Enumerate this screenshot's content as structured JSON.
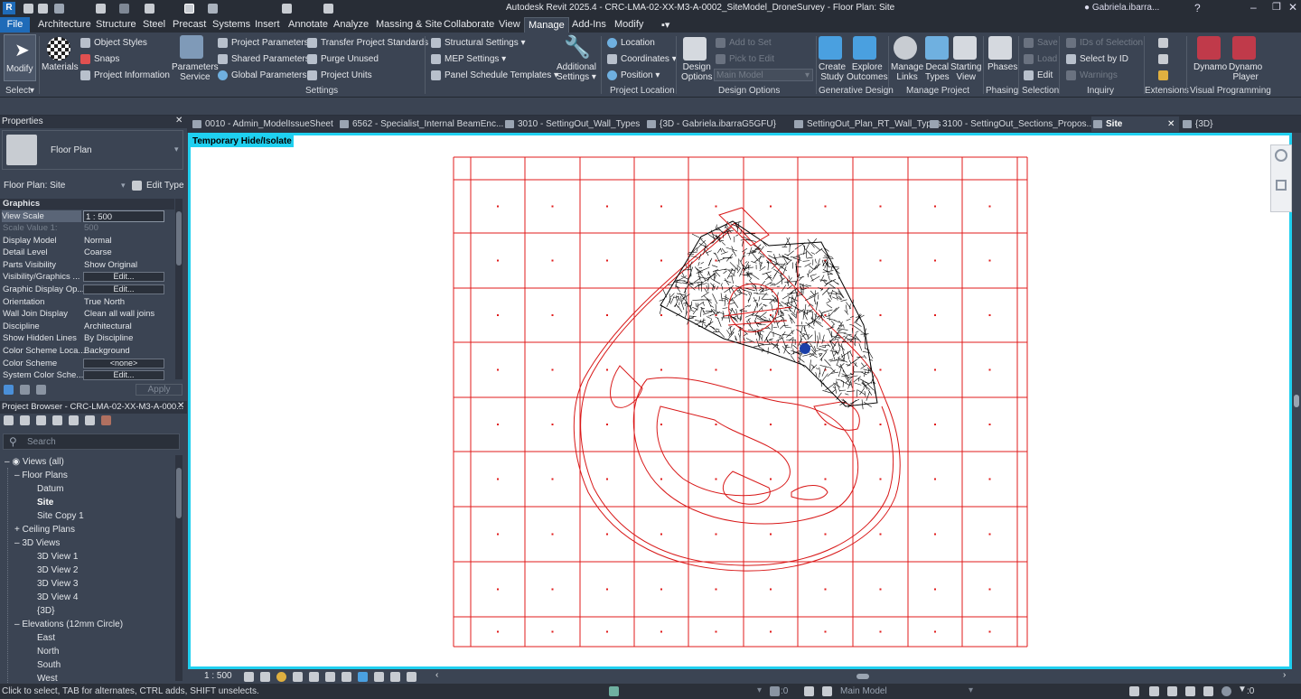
{
  "title": "Autodesk Revit 2025.4 - CRC-LMA-02-XX-M3-A-0002_SiteModel_DroneSurvey - Floor Plan: Site",
  "user": "Gabriela.ibarra...",
  "menu": [
    "File",
    "Architecture",
    "Structure",
    "Steel",
    "Precast",
    "Systems",
    "Insert",
    "Annotate",
    "Analyze",
    "Massing & Site",
    "Collaborate",
    "View",
    "Manage",
    "Add-Ins",
    "Modify"
  ],
  "ribbon": {
    "modify": "Modify",
    "select": "Select",
    "materials": "Materials",
    "object_styles": "Object Styles",
    "snaps": "Snaps",
    "project_information": "Project Information",
    "parameters_service": "Parameters Service",
    "project_parameters": "Project Parameters",
    "shared_parameters": "Shared Parameters",
    "global_parameters": "Global Parameters",
    "transfer_standards": "Transfer Project Standards",
    "purge_unused": "Purge Unused",
    "project_units": "Project Units",
    "settings_group": "Settings",
    "structural_settings": "Structural Settings",
    "mep_settings": "MEP Settings",
    "panel_schedule": "Panel Schedule Templates",
    "additional_settings": "Additional Settings",
    "location": "Location",
    "coordinates": "Coordinates",
    "position": "Position",
    "project_location_group": "Project Location",
    "design_options": "Design Options",
    "add_to_set": "Add to Set",
    "pick_to_edit": "Pick to Edit",
    "main_model": "Main Model",
    "design_options_group": "Design Options",
    "create_study": "Create Study",
    "explore_outcomes": "Explore Outcomes",
    "generative_design_group": "Generative Design",
    "manage_links": "Manage Links",
    "decal_types": "Decal Types",
    "starting_view": "Starting View",
    "manage_project_group": "Manage Project",
    "phases": "Phases",
    "phasing_group": "Phasing",
    "save": "Save",
    "load": "Load",
    "edit": "Edit",
    "selection_group": "Selection",
    "ids_of_selection": "IDs of Selection",
    "select_by_id": "Select by ID",
    "warnings": "Warnings",
    "inquiry_group": "Inquiry",
    "extensions_group": "Extensions",
    "dynamo": "Dynamo",
    "dynamo_player": "Dynamo Player",
    "visual_programming_group": "Visual Programming"
  },
  "properties": {
    "header": "Properties",
    "type_name": "Floor Plan",
    "selector": "Floor Plan: Site",
    "edit_type": "Edit Type",
    "section": "Graphics",
    "rows": [
      {
        "label": "View Scale",
        "value": "1 : 500"
      },
      {
        "label": "Scale Value    1:",
        "value": "500"
      },
      {
        "label": "Display Model",
        "value": "Normal"
      },
      {
        "label": "Detail Level",
        "value": "Coarse"
      },
      {
        "label": "Parts Visibility",
        "value": "Show Original"
      },
      {
        "label": "Visibility/Graphics ...",
        "value": "Edit..."
      },
      {
        "label": "Graphic Display Op...",
        "value": "Edit..."
      },
      {
        "label": "Orientation",
        "value": "True North"
      },
      {
        "label": "Wall Join Display",
        "value": "Clean all wall joins"
      },
      {
        "label": "Discipline",
        "value": "Architectural"
      },
      {
        "label": "Show Hidden Lines",
        "value": "By Discipline"
      },
      {
        "label": "Color Scheme Loca...",
        "value": "Background"
      },
      {
        "label": "Color Scheme",
        "value": "<none>"
      },
      {
        "label": "System Color Sche...",
        "value": "Edit..."
      }
    ],
    "apply": "Apply"
  },
  "browser": {
    "header": "Project Browser - CRC-LMA-02-XX-M3-A-000...",
    "search_placeholder": "Search",
    "items": [
      {
        "label": "Views (all)",
        "indent": 0
      },
      {
        "label": "Floor Plans",
        "indent": 1
      },
      {
        "label": "Datum",
        "indent": 2
      },
      {
        "label": "Site",
        "indent": 2,
        "bold": true
      },
      {
        "label": "Site Copy 1",
        "indent": 2
      },
      {
        "label": "Ceiling Plans",
        "indent": 1
      },
      {
        "label": "3D Views",
        "indent": 1
      },
      {
        "label": "3D View 1",
        "indent": 2
      },
      {
        "label": "3D View 2",
        "indent": 2
      },
      {
        "label": "3D View 3",
        "indent": 2
      },
      {
        "label": "3D View 4",
        "indent": 2
      },
      {
        "label": "{3D}",
        "indent": 2
      },
      {
        "label": "Elevations (12mm Circle)",
        "indent": 1
      },
      {
        "label": "East",
        "indent": 2
      },
      {
        "label": "North",
        "indent": 2
      },
      {
        "label": "South",
        "indent": 2
      },
      {
        "label": "West",
        "indent": 2
      }
    ]
  },
  "tabs": [
    "0010 - Admin_ModelIssueSheet",
    "6562 - Specialist_Internal BeamEnc...",
    "3010 - SettingOut_Wall_Types",
    "{3D - Gabriela.ibarraG5GFU}",
    "SettingOut_Plan_RT_Wall_Types",
    "3100 - SettingOut_Sections_Propos...",
    "Site",
    "{3D}"
  ],
  "canvas": {
    "temp_label": "Temporary Hide/Isolate"
  },
  "view_control": {
    "scale": "1 : 500"
  },
  "status": {
    "hint": "Click to select, TAB for alternates, CTRL adds, SHIFT unselects.",
    "count": ":0",
    "model": "Main Model",
    "filter_count": ":0"
  },
  "colors": {
    "accent": "#1fd0f0",
    "grid": "#e01b1b",
    "file": "#1f6bb8"
  }
}
